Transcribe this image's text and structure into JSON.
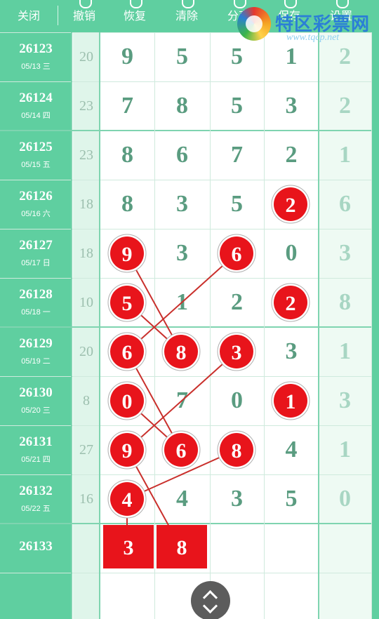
{
  "toolbar": {
    "buttons": [
      {
        "label": "关闭"
      },
      {
        "label": "撤销"
      },
      {
        "label": "恢复"
      },
      {
        "label": "清除"
      },
      {
        "label": "分享"
      },
      {
        "label": "保存"
      },
      {
        "label": "设置"
      }
    ]
  },
  "logo": {
    "name": "特区彩票网",
    "url": "www.tqcp.net"
  },
  "colors": {
    "accent": "#5fcfa0",
    "ball": "#e8141b",
    "digit": "#5a9c80"
  },
  "rows": [
    {
      "issue": "26123",
      "date": "05/13 三",
      "sum": "20",
      "digits": [
        "9",
        "5",
        "5",
        "1",
        "2"
      ],
      "hits": []
    },
    {
      "issue": "26124",
      "date": "05/14 四",
      "sum": "23",
      "digits": [
        "7",
        "8",
        "5",
        "3",
        "2"
      ],
      "hits": []
    },
    {
      "issue": "26125",
      "date": "05/15 五",
      "sum": "23",
      "digits": [
        "8",
        "6",
        "7",
        "2",
        "1"
      ],
      "hits": []
    },
    {
      "issue": "26126",
      "date": "05/16 六",
      "sum": "18",
      "digits": [
        "8",
        "3",
        "5",
        "2",
        "6"
      ],
      "hits": [
        3
      ]
    },
    {
      "issue": "26127",
      "date": "05/17 日",
      "sum": "18",
      "digits": [
        "9",
        "3",
        "6",
        "0",
        "3"
      ],
      "hits": [
        0,
        2
      ]
    },
    {
      "issue": "26128",
      "date": "05/18 一",
      "sum": "10",
      "digits": [
        "5",
        "1",
        "2",
        "2",
        "8"
      ],
      "hits": [
        0,
        3
      ]
    },
    {
      "issue": "26129",
      "date": "05/19 二",
      "sum": "20",
      "digits": [
        "6",
        "8",
        "3",
        "3",
        "1"
      ],
      "hits": [
        0,
        1,
        2
      ]
    },
    {
      "issue": "26130",
      "date": "05/20 三",
      "sum": "8",
      "digits": [
        "0",
        "7",
        "0",
        "1",
        "3"
      ],
      "hits": [
        0,
        3
      ]
    },
    {
      "issue": "26131",
      "date": "05/21 四",
      "sum": "27",
      "digits": [
        "9",
        "6",
        "8",
        "4",
        "1"
      ],
      "hits": [
        0,
        1,
        2
      ]
    },
    {
      "issue": "26132",
      "date": "05/22 五",
      "sum": "16",
      "digits": [
        "4",
        "4",
        "3",
        "5",
        "0"
      ],
      "hits": [
        0
      ]
    }
  ],
  "next_issue": {
    "issue": "26133",
    "predictions": [
      "3",
      "8"
    ]
  },
  "lines": [
    [
      [
        4,
        0
      ],
      [
        6,
        1
      ]
    ],
    [
      [
        5,
        0
      ],
      [
        6,
        1
      ]
    ],
    [
      [
        4,
        2
      ],
      [
        6,
        0
      ]
    ],
    [
      [
        6,
        2
      ],
      [
        8,
        0
      ]
    ],
    [
      [
        6,
        0
      ],
      [
        8,
        1
      ]
    ],
    [
      [
        7,
        0
      ],
      [
        8,
        1
      ]
    ],
    [
      [
        8,
        2
      ],
      [
        9,
        0
      ]
    ],
    [
      [
        8,
        0
      ],
      [
        10,
        1
      ]
    ],
    [
      [
        9,
        0
      ],
      [
        10,
        0
      ]
    ]
  ]
}
